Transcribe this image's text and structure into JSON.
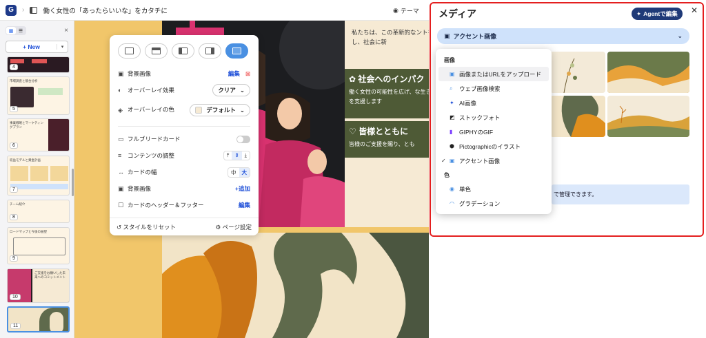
{
  "topbar": {
    "logo": "G",
    "title": "働く女性の「あったらいいな」をカタチに",
    "theme_label": "テーマ"
  },
  "sidebar": {
    "new_label": "New",
    "thumbs": [
      {
        "num": "4",
        "title": ""
      },
      {
        "num": "5",
        "title": "市場調査と競合分析"
      },
      {
        "num": "6",
        "title": "事業戦略とマーケティングプラン"
      },
      {
        "num": "7",
        "title": "収益モデルと資金計画"
      },
      {
        "num": "8",
        "title": "チーム紹介"
      },
      {
        "num": "9",
        "title": "ロードマップと今後の展望"
      },
      {
        "num": "10",
        "title": "ご支援をお願いした未来へのコミットメント"
      },
      {
        "num": "11",
        "title": ""
      }
    ]
  },
  "slide": {
    "intro": "私たちは、この革新的なントを実現し、社会に新",
    "box1_title": "社会へのインパク",
    "box1_body": "働く女性の可能性を広げ、な生き方を支援します",
    "box2_title": "皆様とともに",
    "box2_body": "皆様のご支援を賜り、とも"
  },
  "panel": {
    "rows": [
      {
        "label": "背景画像",
        "action": "編集"
      },
      {
        "label": "オーバーレイ効果",
        "value": "クリア"
      },
      {
        "label": "オーバーレイの色",
        "value": "デフォルト"
      },
      {
        "label": "フルブリードカード"
      },
      {
        "label": "コンテンツの調整"
      },
      {
        "label": "カードの幅",
        "opt1": "中",
        "opt2": "大"
      },
      {
        "label": "背景画像",
        "action": "+追加"
      },
      {
        "label": "カードのヘッダー＆フッター",
        "action": "編集"
      }
    ],
    "reset": "スタイルをリセット",
    "page_settings": "ページ設定"
  },
  "media": {
    "title": "メディア",
    "agent_btn": "Agentで編集",
    "source": "アクセント画像",
    "info": "で管理できます。",
    "menu": {
      "h_image": "画像",
      "h_color": "色",
      "items": [
        {
          "label": "画像またはURLをアップロード",
          "icon": "image-icon"
        },
        {
          "label": "ウェブ画像検索",
          "icon": "search-icon"
        },
        {
          "label": "AI画像",
          "icon": "sparkle-icon"
        },
        {
          "label": "ストックフォト",
          "icon": "photo-icon"
        },
        {
          "label": "GIPHYのGIF",
          "icon": "giphy-icon"
        },
        {
          "label": "Pictographicのイラスト",
          "icon": "pictographic-icon"
        },
        {
          "label": "アクセント画像",
          "icon": "accent-image-icon",
          "checked": true
        }
      ],
      "color_items": [
        {
          "label": "単色",
          "icon": "solid-color-icon"
        },
        {
          "label": "グラデーション",
          "icon": "gradient-icon"
        }
      ]
    }
  },
  "colors": {
    "accent": "#1d4ed8",
    "highlight": "#e41f1f",
    "olive": "#4e5a36"
  }
}
